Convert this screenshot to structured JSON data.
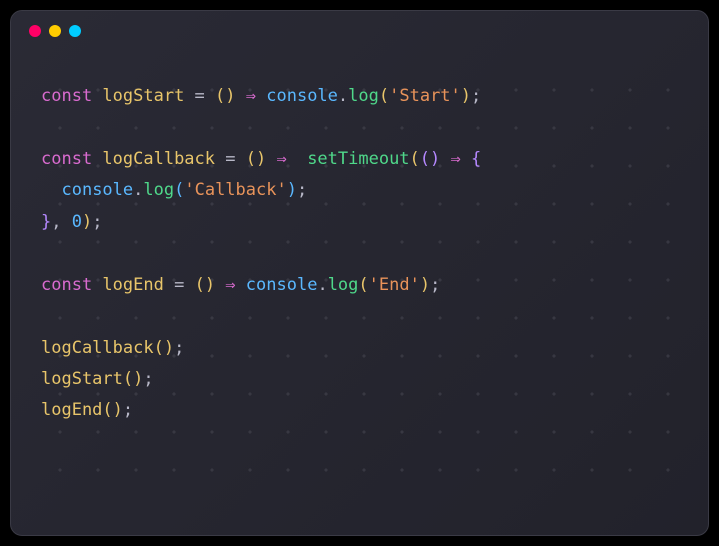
{
  "window": {
    "traffic_lights": {
      "close_color": "#ff0066",
      "min_color": "#ffcc00",
      "max_color": "#00ccff"
    }
  },
  "code": {
    "lines": [
      {
        "tokens": [
          {
            "t": "const ",
            "c": "tk-keyword"
          },
          {
            "t": "logStart ",
            "c": "tk-const-name"
          },
          {
            "t": "= ",
            "c": "tk-equals"
          },
          {
            "t": "(",
            "c": "tk-paren-yellow"
          },
          {
            "t": ") ",
            "c": "tk-paren-yellow"
          },
          {
            "t": "⇒ ",
            "c": "tk-arrow"
          },
          {
            "t": "console",
            "c": "tk-object"
          },
          {
            "t": ".",
            "c": "tk-punct"
          },
          {
            "t": "log",
            "c": "tk-method"
          },
          {
            "t": "(",
            "c": "tk-paren-yellow"
          },
          {
            "t": "'Start'",
            "c": "tk-string"
          },
          {
            "t": ")",
            "c": "tk-paren-yellow"
          },
          {
            "t": ";",
            "c": "tk-punct"
          }
        ]
      },
      {
        "tokens": []
      },
      {
        "tokens": [
          {
            "t": "const ",
            "c": "tk-keyword"
          },
          {
            "t": "logCallback ",
            "c": "tk-const-name"
          },
          {
            "t": "= ",
            "c": "tk-equals"
          },
          {
            "t": "(",
            "c": "tk-paren-yellow"
          },
          {
            "t": ") ",
            "c": "tk-paren-yellow"
          },
          {
            "t": "⇒  ",
            "c": "tk-arrow"
          },
          {
            "t": "setTimeout",
            "c": "tk-func"
          },
          {
            "t": "(",
            "c": "tk-paren-yellow"
          },
          {
            "t": "(",
            "c": "tk-paren-purple"
          },
          {
            "t": ") ",
            "c": "tk-paren-purple"
          },
          {
            "t": "⇒ ",
            "c": "tk-arrow"
          },
          {
            "t": "{",
            "c": "tk-paren-purple"
          }
        ]
      },
      {
        "tokens": [
          {
            "t": "  ",
            "c": ""
          },
          {
            "t": "console",
            "c": "tk-object"
          },
          {
            "t": ".",
            "c": "tk-punct"
          },
          {
            "t": "log",
            "c": "tk-method"
          },
          {
            "t": "(",
            "c": "tk-paren-blue"
          },
          {
            "t": "'Callback'",
            "c": "tk-string"
          },
          {
            "t": ")",
            "c": "tk-paren-blue"
          },
          {
            "t": ";",
            "c": "tk-punct"
          }
        ]
      },
      {
        "tokens": [
          {
            "t": "}",
            "c": "tk-paren-purple"
          },
          {
            "t": ", ",
            "c": "tk-punct"
          },
          {
            "t": "0",
            "c": "tk-number"
          },
          {
            "t": ")",
            "c": "tk-paren-yellow"
          },
          {
            "t": ";",
            "c": "tk-punct"
          }
        ]
      },
      {
        "tokens": []
      },
      {
        "tokens": [
          {
            "t": "const ",
            "c": "tk-keyword"
          },
          {
            "t": "logEnd ",
            "c": "tk-const-name"
          },
          {
            "t": "= ",
            "c": "tk-equals"
          },
          {
            "t": "(",
            "c": "tk-paren-yellow"
          },
          {
            "t": ") ",
            "c": "tk-paren-yellow"
          },
          {
            "t": "⇒ ",
            "c": "tk-arrow"
          },
          {
            "t": "console",
            "c": "tk-object"
          },
          {
            "t": ".",
            "c": "tk-punct"
          },
          {
            "t": "log",
            "c": "tk-method"
          },
          {
            "t": "(",
            "c": "tk-paren-yellow"
          },
          {
            "t": "'End'",
            "c": "tk-string"
          },
          {
            "t": ")",
            "c": "tk-paren-yellow"
          },
          {
            "t": ";",
            "c": "tk-punct"
          }
        ]
      },
      {
        "tokens": []
      },
      {
        "tokens": [
          {
            "t": "logCallback",
            "c": "tk-call"
          },
          {
            "t": "(",
            "c": "tk-paren-yellow"
          },
          {
            "t": ")",
            "c": "tk-paren-yellow"
          },
          {
            "t": ";",
            "c": "tk-punct"
          }
        ]
      },
      {
        "tokens": [
          {
            "t": "logStart",
            "c": "tk-call"
          },
          {
            "t": "(",
            "c": "tk-paren-yellow"
          },
          {
            "t": ")",
            "c": "tk-paren-yellow"
          },
          {
            "t": ";",
            "c": "tk-punct"
          }
        ]
      },
      {
        "tokens": [
          {
            "t": "logEnd",
            "c": "tk-call"
          },
          {
            "t": "(",
            "c": "tk-paren-yellow"
          },
          {
            "t": ")",
            "c": "tk-paren-yellow"
          },
          {
            "t": ";",
            "c": "tk-punct"
          }
        ]
      }
    ]
  }
}
